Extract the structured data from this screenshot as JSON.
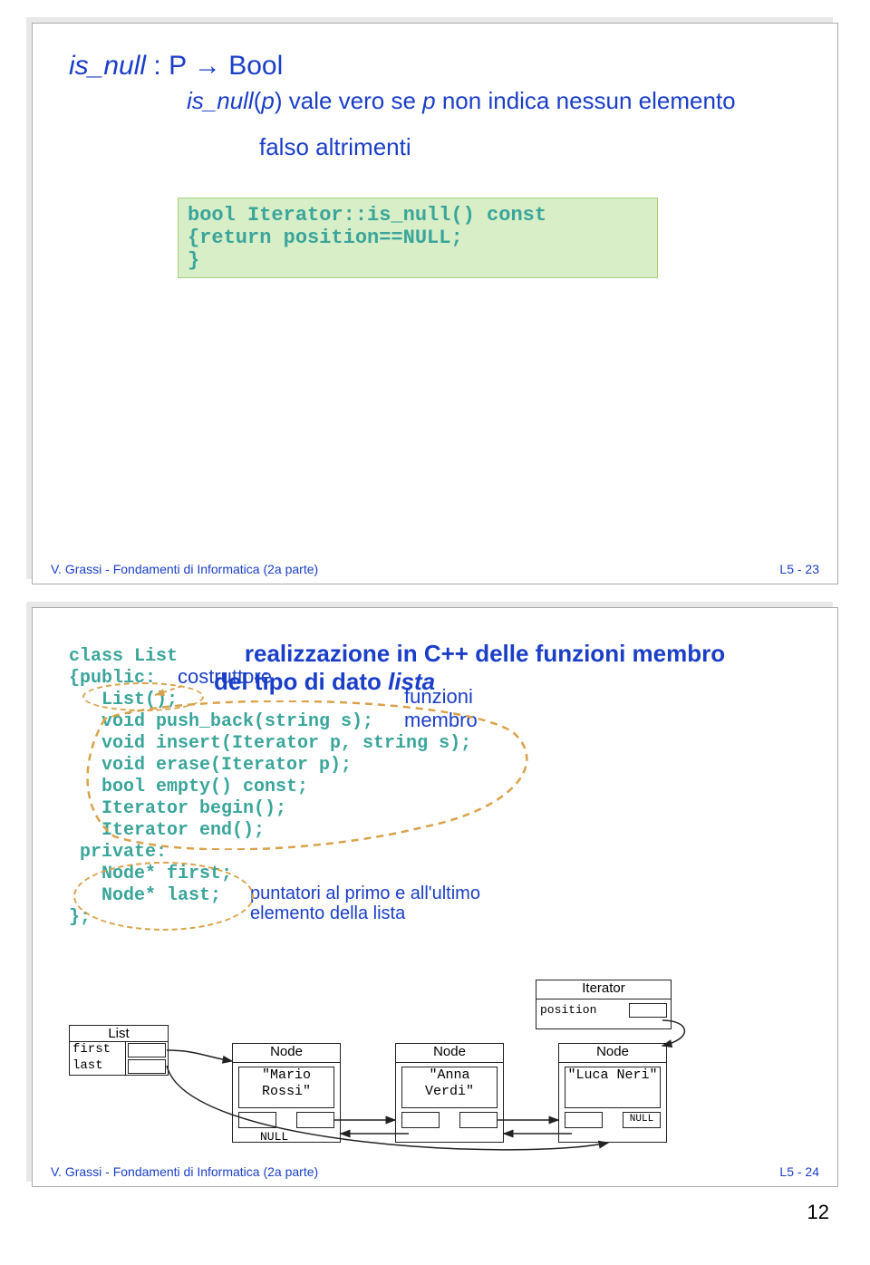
{
  "slide1": {
    "title_left": "is_null",
    "title_mid": " : P ",
    "arrow": "→",
    "title_right": " Bool",
    "subA1": "is_null",
    "subA2": "(",
    "subA3": "p",
    "subA4": ") vale vero se ",
    "subA5": "p",
    "subA6": " non indica nessun elemento",
    "subB": "falso altrimenti",
    "code1": "bool Iterator::is_null() const",
    "code2": "  {return position==NULL;",
    "code3": "  }",
    "footerL": "V. Grassi - Fondamenti di Informatica (2a parte)",
    "footerR": "L5 - 23"
  },
  "slide2": {
    "title1": "realizzazione in C++ delle funzioni membro",
    "title2a": "del tipo di dato ",
    "title2b": "lista",
    "ann_costruttore": "costruttore",
    "ann_funzioni": "funzioni",
    "ann_membro": "membro",
    "ann_punt": "puntatori al primo e all'ultimo elemento della lista",
    "code": {
      "l1": "class List",
      "l2": "{public:",
      "l3": "   List();",
      "l4": "   void push_back(string s);",
      "l5": "   void insert(Iterator p, string s);",
      "l6": "   void erase(Iterator p);",
      "l7": "   bool empty() const;",
      "l8": "   Iterator begin();",
      "l9": "   Iterator end();",
      "l10": " private:",
      "l11": "   Node* first;",
      "l12": "   Node* last;",
      "l13": "};"
    },
    "diagram": {
      "list_title": "List",
      "first": "first",
      "last": "last",
      "node_title": "Node",
      "n1": "\"Mario Rossi\"",
      "n2": "\"Anna Verdi\"",
      "n3": "\"Luca Neri\"",
      "null": "NULL",
      "iter_title": "Iterator",
      "position": "position"
    },
    "footerL": "V. Grassi - Fondamenti di Informatica (2a parte)",
    "footerR": "L5 - 24"
  },
  "page_number": "12"
}
